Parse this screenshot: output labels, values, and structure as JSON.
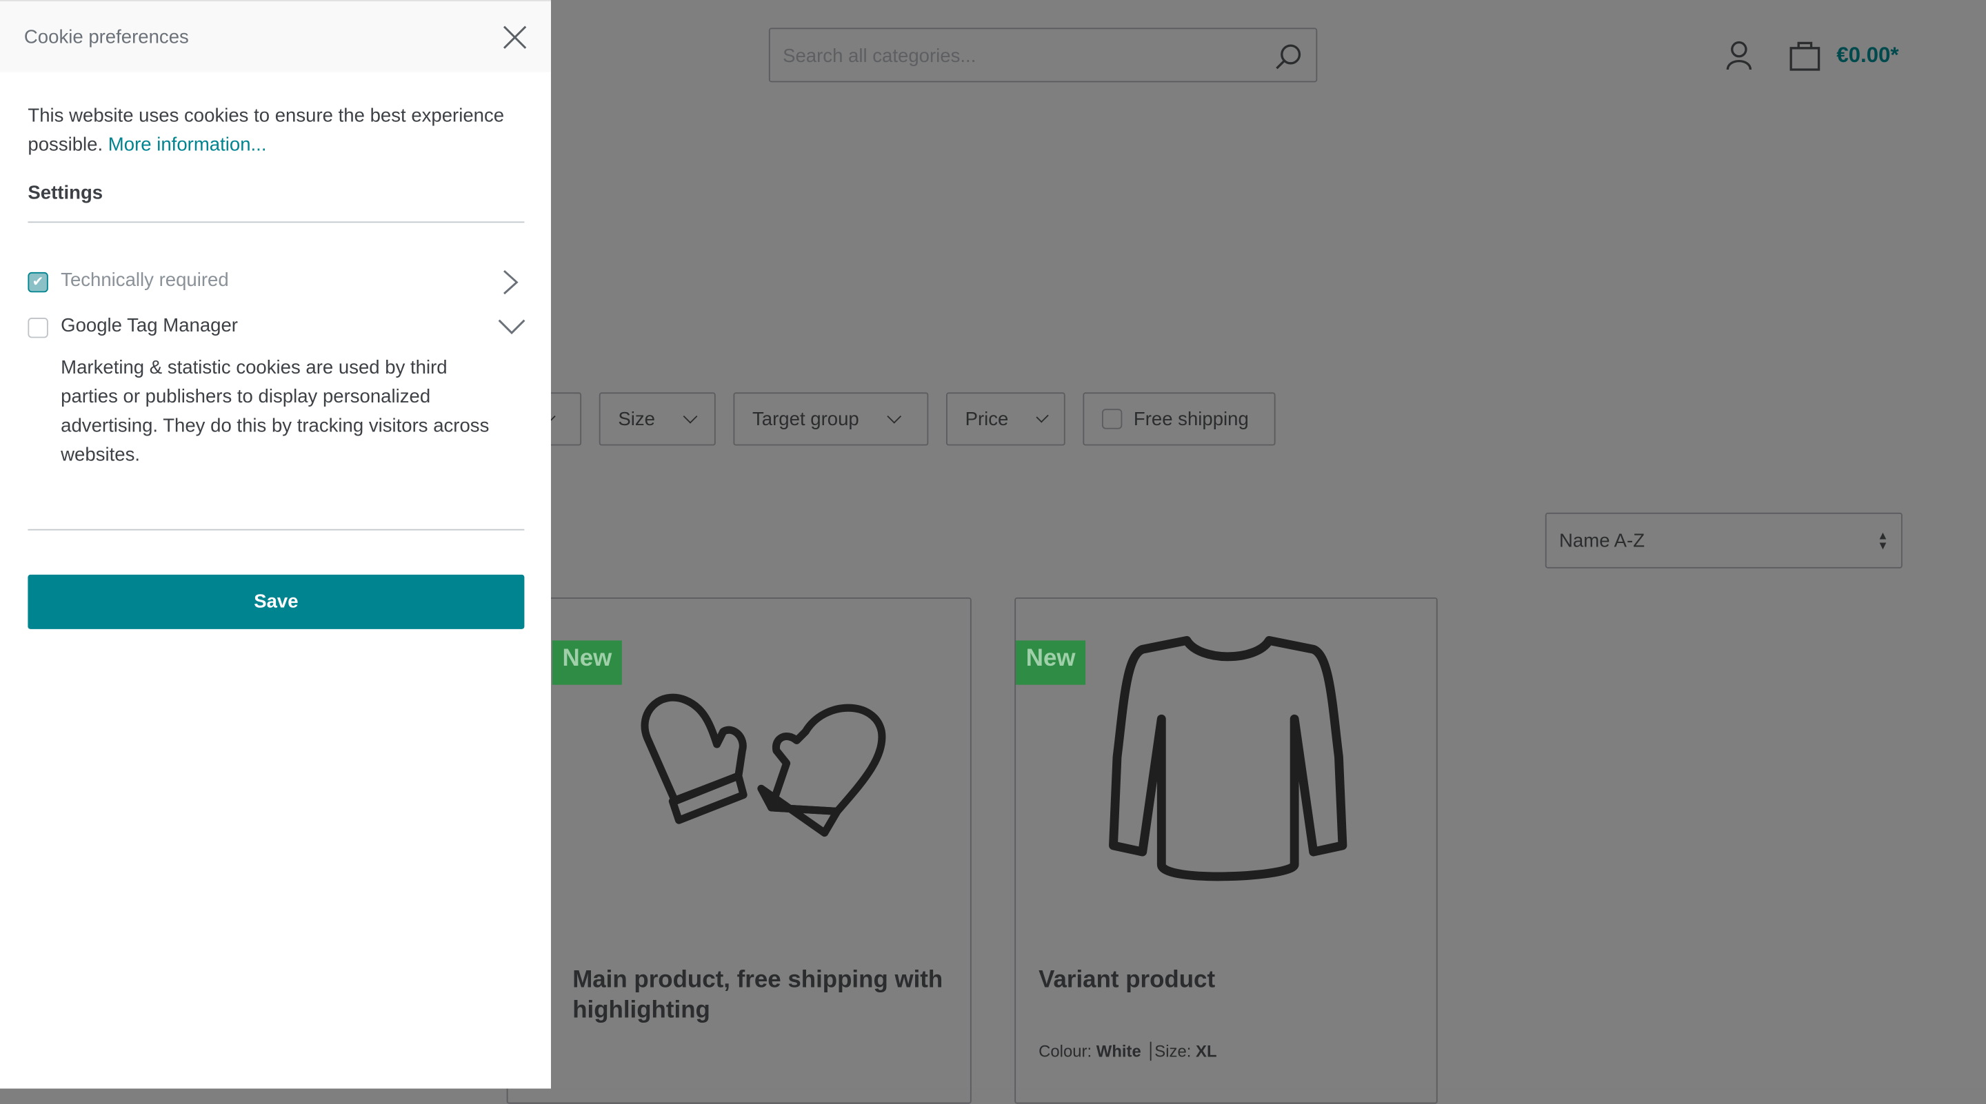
{
  "header": {
    "search_placeholder": "Search all categories...",
    "cart_total": "€0.00*"
  },
  "filters": [
    {
      "label": "Size"
    },
    {
      "label": "Target group"
    },
    {
      "label": "Price"
    }
  ],
  "free_shipping_label": "Free shipping",
  "sort": {
    "selected": "Name A-Z"
  },
  "products": [
    {
      "badge": "New",
      "title": "Main product, free shipping with highlighting"
    },
    {
      "badge": "New",
      "title": "Variant product",
      "colour_label": "Colour:",
      "colour_value": "White",
      "size_label": "Size:",
      "size_value": "XL"
    }
  ],
  "cookie_panel": {
    "title": "Cookie preferences",
    "intro": "This website uses cookies to ensure the best experience possible.",
    "more_info": "More information...",
    "settings_heading": "Settings",
    "options": [
      {
        "label": "Technically required",
        "checked": true
      },
      {
        "label": "Google Tag Manager",
        "checked": false,
        "description": "Marketing & statistic cookies are used by third parties or publishers to display personalized advertising. They do this by tracking visitors across websites."
      }
    ],
    "save_label": "Save"
  },
  "colors": {
    "accent": "#008490",
    "overlay_bg": "#7f7f7f",
    "badge": "#2f8c44"
  }
}
